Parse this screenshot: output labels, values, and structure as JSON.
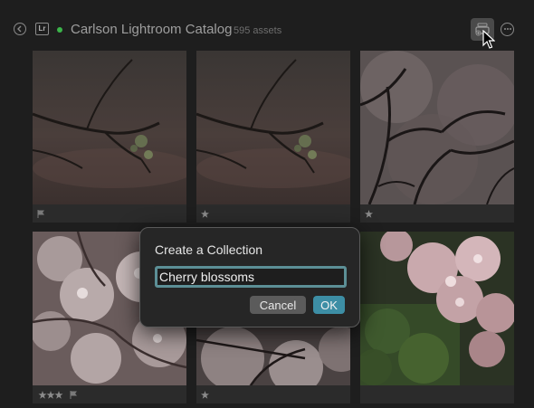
{
  "header": {
    "back_icon": "chevron-left-circle-icon",
    "lr_badge": "Lr",
    "status_color": "#3bb54a",
    "catalog_title": "Carlson Lightroom Catalog",
    "asset_count": "595 assets",
    "collection_icon": "add-collection-icon",
    "more_icon": "ellipsis-circle-icon"
  },
  "grid": {
    "items": [
      {
        "id": "photo-1",
        "footer_icon": "flag-icon",
        "rating_stars": 0,
        "flagged": true
      },
      {
        "id": "photo-2",
        "footer_icon": "star-icon",
        "rating_stars": 1,
        "flagged": false
      },
      {
        "id": "photo-3",
        "footer_icon": "star-icon",
        "rating_stars": 1,
        "flagged": false
      },
      {
        "id": "photo-4",
        "footer_icon": "star-icon",
        "rating_stars": 3,
        "flagged": true
      },
      {
        "id": "photo-5",
        "footer_icon": "star-icon",
        "rating_stars": 1,
        "flagged": false
      },
      {
        "id": "photo-6",
        "footer_icon": "",
        "rating_stars": 0,
        "flagged": false
      }
    ]
  },
  "dialog": {
    "title": "Create a Collection",
    "input_value": "Cherry blossoms",
    "cancel_label": "Cancel",
    "ok_label": "OK",
    "accent_color": "#3d8ea5"
  }
}
